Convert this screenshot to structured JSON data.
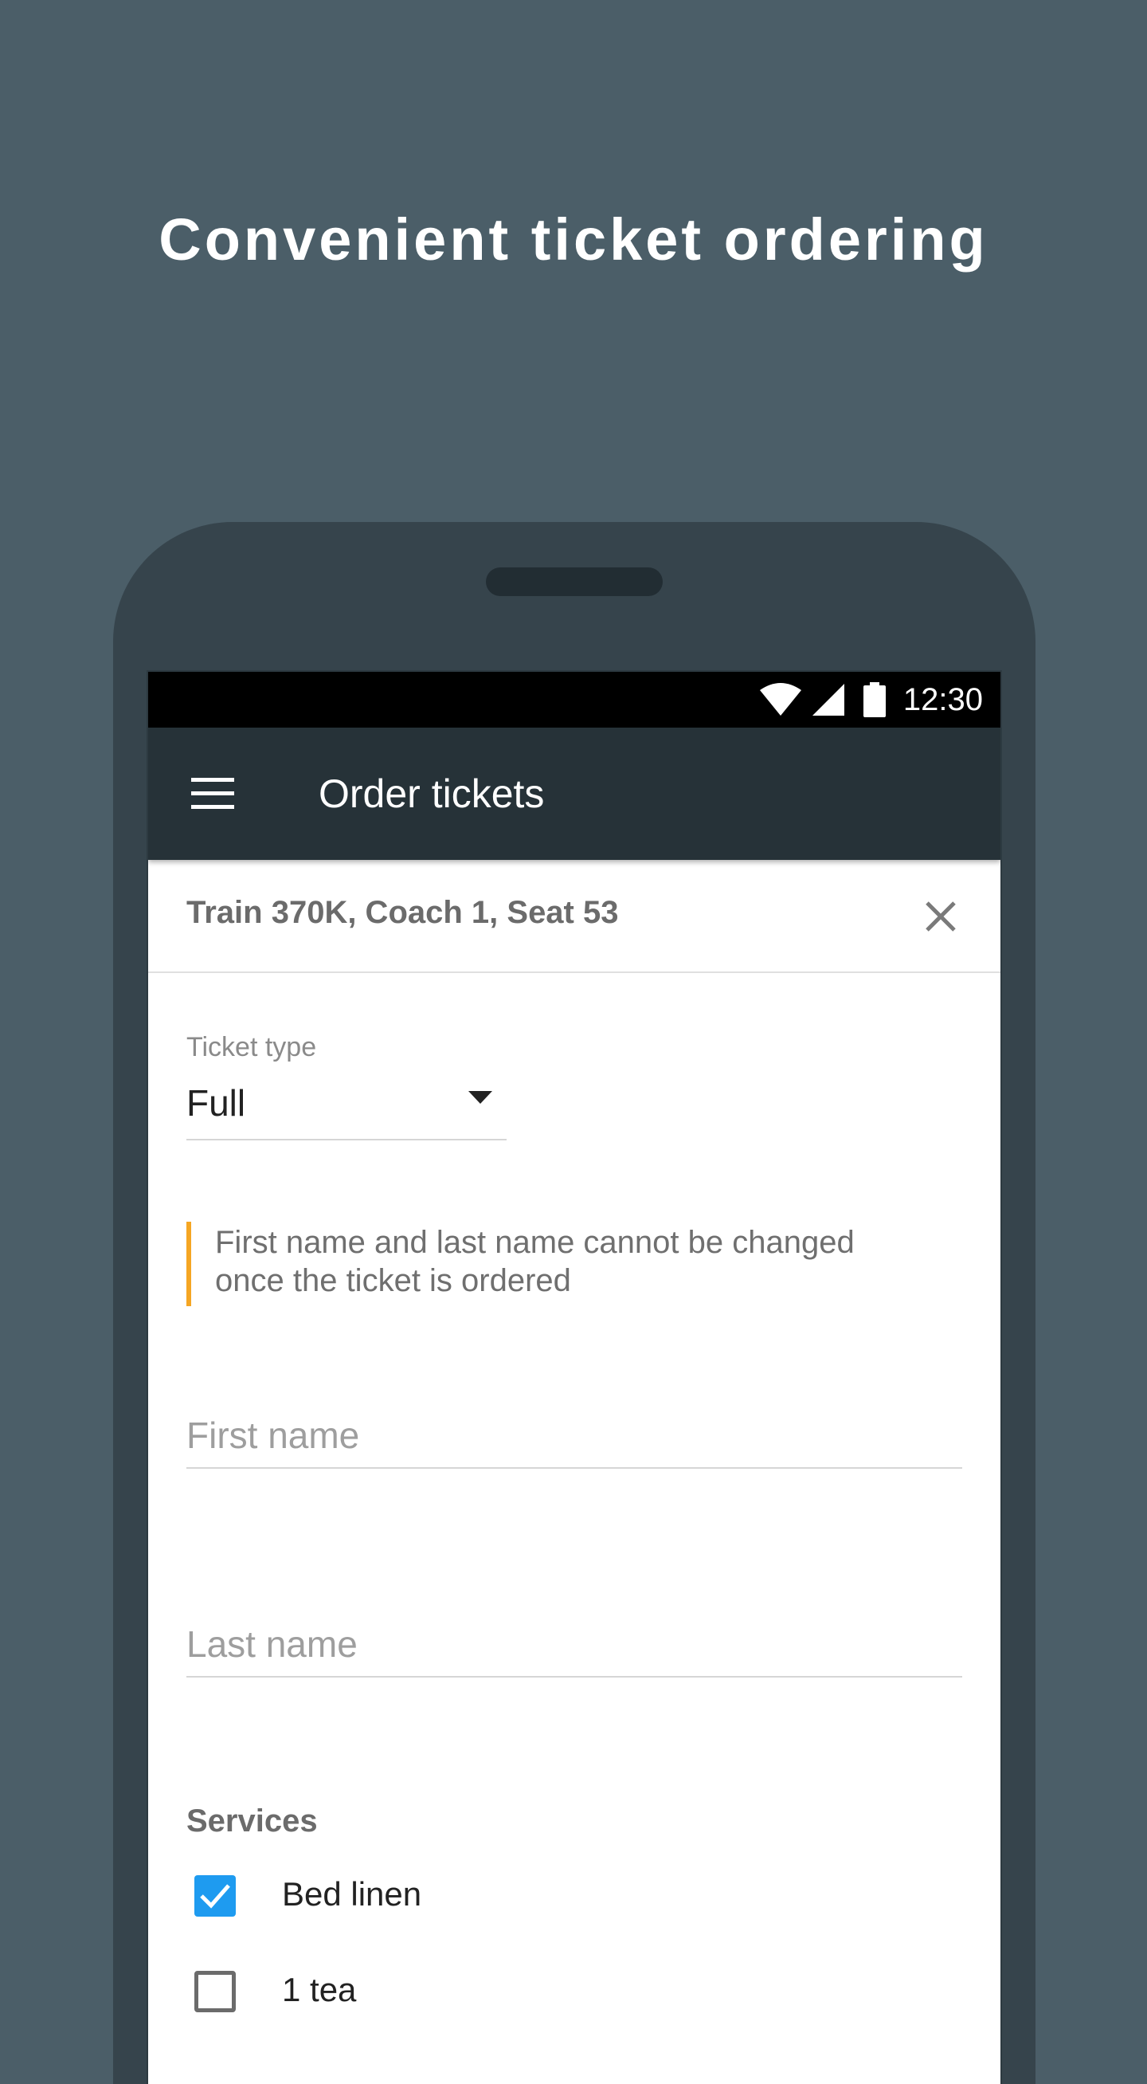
{
  "headline": "Convenient ticket ordering",
  "status_bar": {
    "time": "12:30",
    "icons": [
      "wifi-icon",
      "signal-icon",
      "battery-icon"
    ]
  },
  "app_bar": {
    "title": "Order tickets",
    "menu_icon": "menu-icon"
  },
  "trip": {
    "summary": "Train 370K, Coach 1, Seat 53",
    "close_icon": "close-icon"
  },
  "form": {
    "ticket_type_label": "Ticket type",
    "ticket_type_value": "Full",
    "notice": "First name and last name cannot be changed once the ticket is ordered",
    "first_name_placeholder": "First name",
    "last_name_placeholder": "Last name",
    "services_heading": "Services",
    "services": [
      {
        "label": "Bed linen",
        "checked": true
      },
      {
        "label": "1 tea",
        "checked": false
      }
    ]
  },
  "colors": {
    "background": "#4b5e68",
    "phone_body": "#36444c",
    "app_bar": "#263238",
    "notice_accent": "#f5a623",
    "checkbox_checked": "#1e9bf0"
  }
}
